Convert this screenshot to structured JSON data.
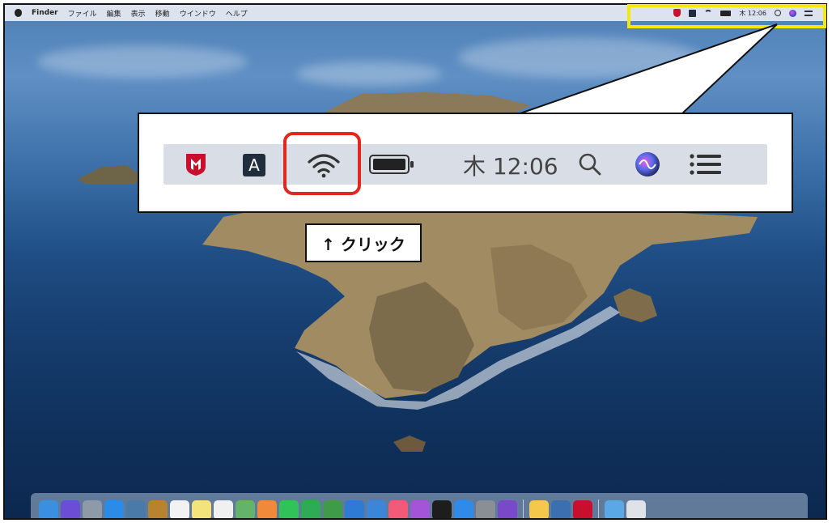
{
  "menubar": {
    "apple_icon": "apple-icon",
    "items": [
      "Finder",
      "ファイル",
      "編集",
      "表示",
      "移動",
      "ウインドウ",
      "ヘルプ"
    ],
    "status": {
      "time": "木 12:06",
      "icons": [
        "mcafee-shield-icon",
        "input-source-a-icon",
        "wifi-icon",
        "battery-icon",
        "spotlight-search-icon",
        "siri-icon",
        "notification-center-icon"
      ]
    }
  },
  "callout": {
    "time": "木 12:06",
    "input_letter": "A"
  },
  "annotation": {
    "click_label": "↑ クリック",
    "highlight_colors": {
      "yellow": "#f5e90c",
      "red": "#e2271e"
    }
  },
  "dock": {
    "icons": [
      {
        "name": "finder-icon",
        "color": "#3b8fe0"
      },
      {
        "name": "siri-icon",
        "color": "#6a4fd6"
      },
      {
        "name": "launchpad-icon",
        "color": "#8f9aa8"
      },
      {
        "name": "safari-icon",
        "color": "#2a8ce6"
      },
      {
        "name": "photo-booth-icon",
        "color": "#4a7aa8"
      },
      {
        "name": "notes-book-icon",
        "color": "#b7832f"
      },
      {
        "name": "calendar-icon",
        "color": "#f2f2f2"
      },
      {
        "name": "notes-icon",
        "color": "#f4e27a"
      },
      {
        "name": "reminders-icon",
        "color": "#f0f0f0"
      },
      {
        "name": "maps-icon",
        "color": "#64b36a"
      },
      {
        "name": "photos-icon",
        "color": "#f08a3a"
      },
      {
        "name": "messages-icon",
        "color": "#32c25a"
      },
      {
        "name": "facetime-icon",
        "color": "#2faa55"
      },
      {
        "name": "numbers-icon",
        "color": "#3f9b4a"
      },
      {
        "name": "charts-icon",
        "color": "#2e7bd6"
      },
      {
        "name": "keynote-icon",
        "color": "#3a86d9"
      },
      {
        "name": "music-icon",
        "color": "#f25a77"
      },
      {
        "name": "podcasts-icon",
        "color": "#a354d9"
      },
      {
        "name": "apple-tv-icon",
        "color": "#1d1d1d"
      },
      {
        "name": "app-store-icon",
        "color": "#2f8ae8"
      },
      {
        "name": "system-preferences-icon",
        "color": "#8a8f96"
      },
      {
        "name": "imovie-icon",
        "color": "#7a49c9"
      },
      {
        "name": "document-icon",
        "color": "#f3c84b"
      },
      {
        "name": "quicktime-icon",
        "color": "#3a6fb0"
      },
      {
        "name": "mcafee-icon",
        "color": "#c8102e"
      },
      {
        "name": "folder-icon",
        "color": "#5aa9e6"
      },
      {
        "name": "trash-icon",
        "color": "#dfe3e8"
      }
    ]
  }
}
